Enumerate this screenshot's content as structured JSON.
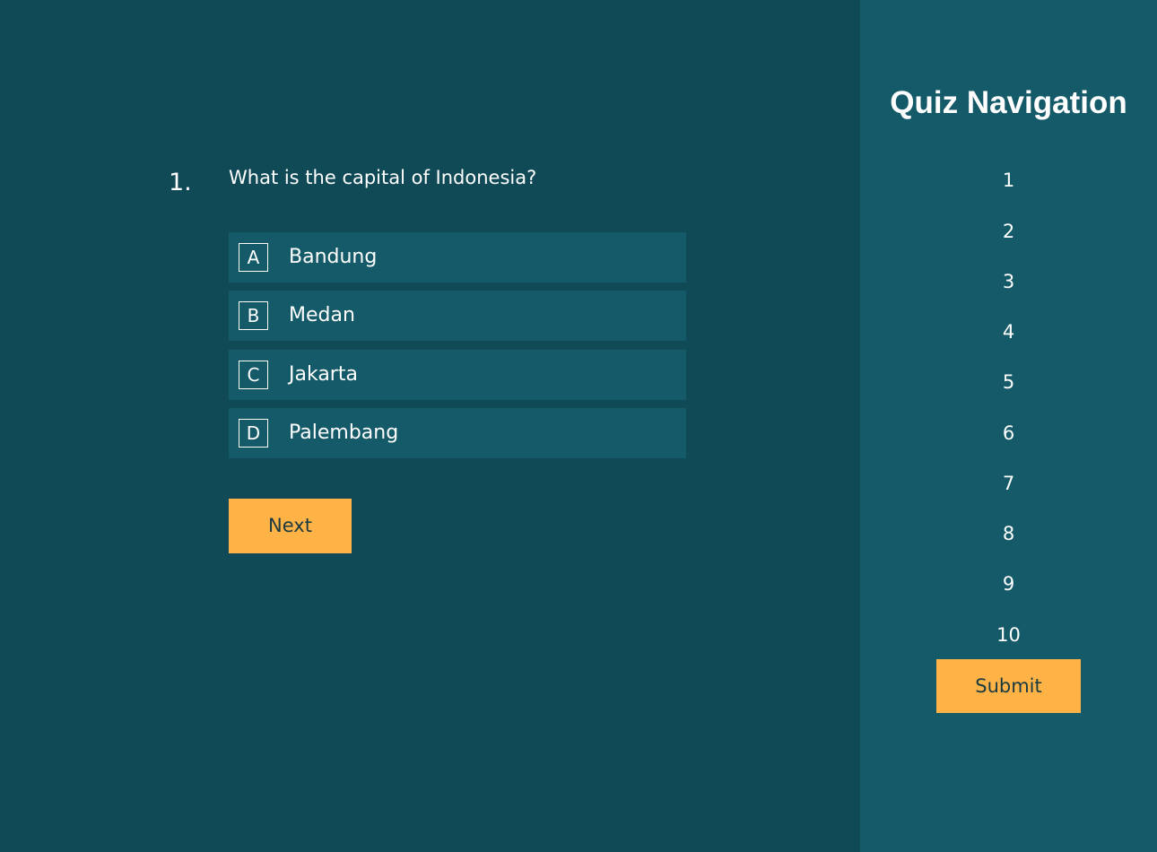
{
  "question": {
    "number": "1.",
    "text": "What is the capital of Indonesia?",
    "options": [
      {
        "letter": "A",
        "label": "Bandung"
      },
      {
        "letter": "B",
        "label": "Medan"
      },
      {
        "letter": "C",
        "label": "Jakarta"
      },
      {
        "letter": "D",
        "label": "Palembang"
      }
    ],
    "next_label": "Next"
  },
  "sidebar": {
    "title": "Quiz Navigation",
    "items": [
      "1",
      "2",
      "3",
      "4",
      "5",
      "6",
      "7",
      "8",
      "9",
      "10"
    ],
    "submit_label": "Submit"
  },
  "colors": {
    "main_bg": "#114a57",
    "sidebar_bg": "#155a68",
    "option_bg": "#155a68",
    "accent": "#ffb347",
    "button_text": "#1a3a40",
    "text": "#ffffff"
  }
}
